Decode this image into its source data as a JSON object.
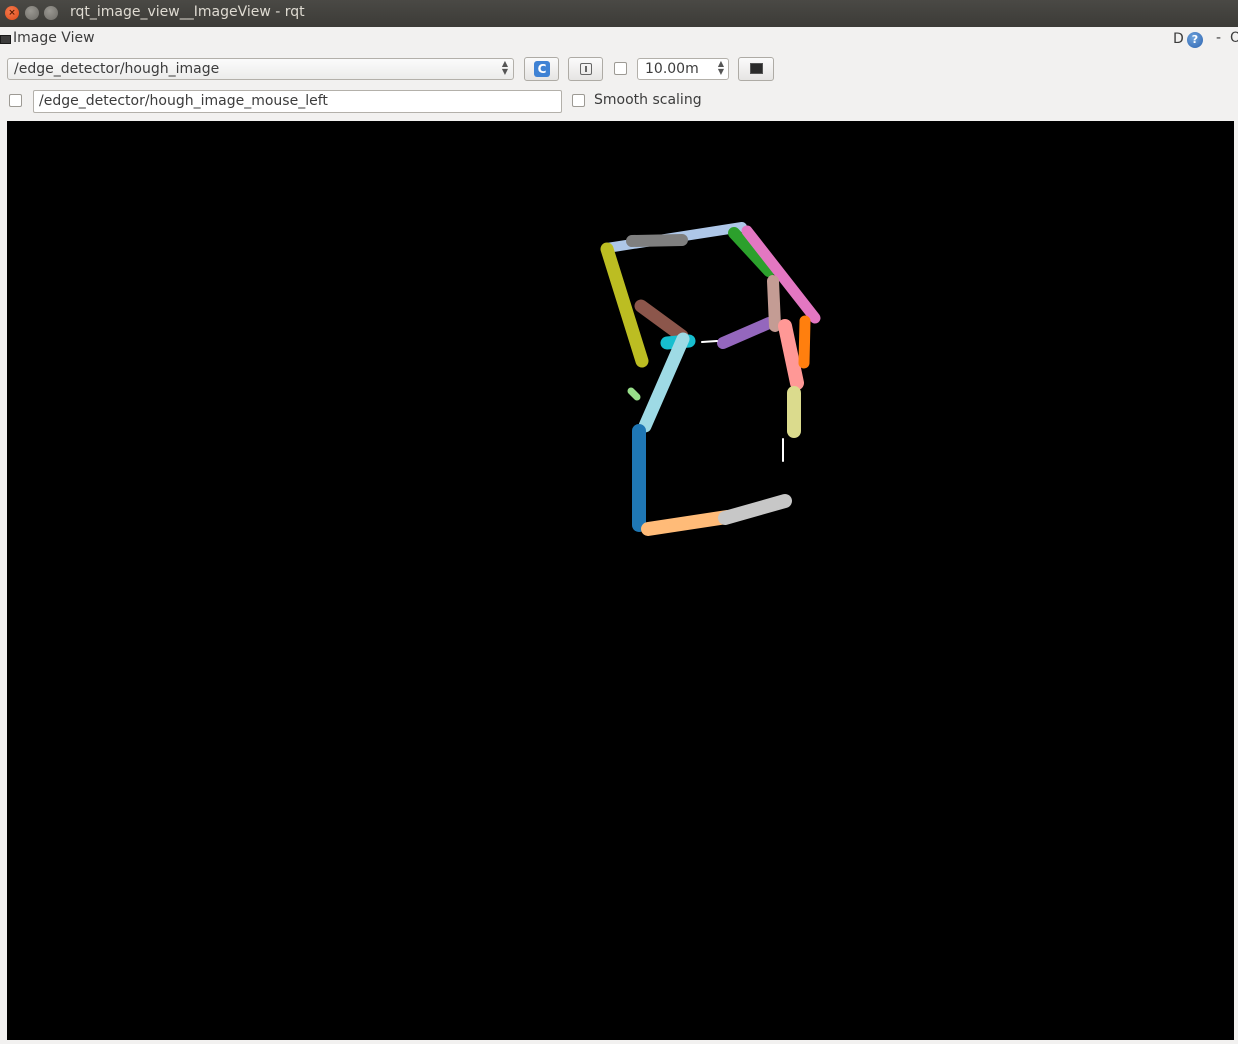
{
  "window": {
    "title": "rqt_image_view__ImageView - rqt"
  },
  "dock": {
    "title": "Image View",
    "d_label": "D",
    "help_glyph": "?",
    "minimize_glyph": "-",
    "close_glyph": "O"
  },
  "toolbar": {
    "topic_selected": "/edge_detector/hough_image",
    "refresh_glyph": "C",
    "zoom_value": "10.00m"
  },
  "mouse_topic": {
    "value": "/edge_detector/hough_image_mouse_left"
  },
  "smooth_scaling": {
    "label": "Smooth scaling",
    "checked": false
  },
  "colors": {
    "image_background": "#000000",
    "segments": [
      "#aec7e8",
      "#7f7f7f",
      "#2ca02c",
      "#e377c2",
      "#bcbd22",
      "#8c564b",
      "#17becf",
      "#9edae5",
      "#1f77b4",
      "#98df8a",
      "#9467bd",
      "#c49c94",
      "#ff9896",
      "#ff7f0e",
      "#dbdb8d",
      "#ffbb78",
      "#c7c7c7",
      "#ffffff"
    ]
  }
}
